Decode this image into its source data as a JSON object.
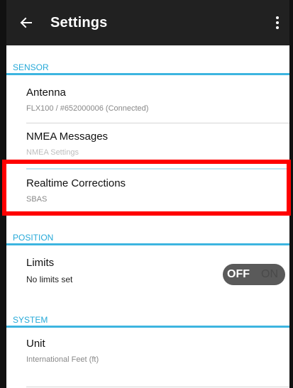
{
  "app_bar": {
    "title": "Settings",
    "back_icon": "arrow-left-icon",
    "menu_icon": "more-vert-icon"
  },
  "sections": {
    "sensor": {
      "label": "SENSOR",
      "items": [
        {
          "title": "Antenna",
          "subtitle": "FLX100 / #652000006 (Connected)"
        },
        {
          "title": "NMEA Messages",
          "subtitle": "NMEA Settings"
        },
        {
          "title": "Realtime Corrections",
          "subtitle": "SBAS"
        }
      ]
    },
    "position": {
      "label": "POSITION",
      "items": [
        {
          "title": "Limits",
          "subtitle": "No limits set",
          "toggle": {
            "off_label": "OFF",
            "on_label": "ON",
            "state": "off"
          }
        }
      ]
    },
    "system": {
      "label": "SYSTEM",
      "items": [
        {
          "title": "Unit",
          "subtitle": "International Feet (ft)"
        }
      ]
    }
  },
  "colors": {
    "app_bar": "#212121",
    "accent": "#26a9d8",
    "highlight": "#ff0000"
  }
}
